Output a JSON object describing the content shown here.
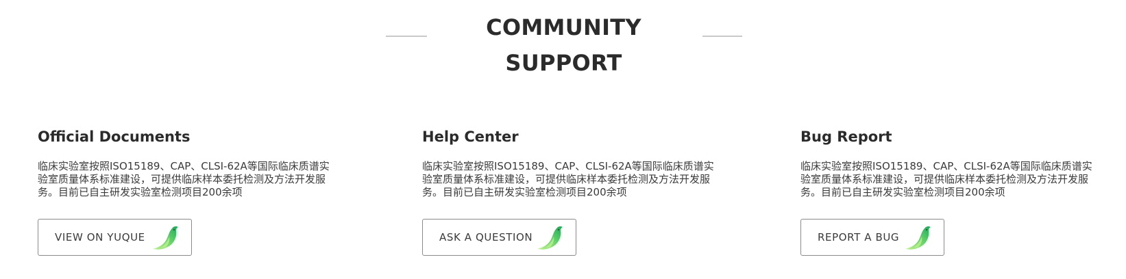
{
  "section": {
    "title": "COMMUNITY SUPPORT"
  },
  "cards": [
    {
      "title": "Official Documents",
      "description": "临床实验室按照ISO15189、CAP、CLSI-62A等国际临床质谱实验室质量体系标准建设，可提供临床样本委托检测及方法开发服务。目前已自主研发实验室检测项目200余项",
      "button_label": "VIEW ON YUQUE",
      "icon": "yuque-bird-icon"
    },
    {
      "title": "Help Center",
      "description": "临床实验室按照ISO15189、CAP、CLSI-62A等国际临床质谱实验室质量体系标准建设，可提供临床样本委托检测及方法开发服务。目前已自主研发实验室检测项目200余项",
      "button_label": "ASK A QUESTION",
      "icon": "yuque-bird-icon"
    },
    {
      "title": "Bug Report",
      "description": "临床实验室按照ISO15189、CAP、CLSI-62A等国际临床质谱实验室质量体系标准建设，可提供临床样本委托检测及方法开发服务。目前已自主研发实验室检测项目200余项",
      "button_label": "REPORT A BUG",
      "icon": "yuque-bird-icon"
    }
  ],
  "colors": {
    "text": "#2b2b2b",
    "rule": "#c9c9c9",
    "button_border": "#8a8a8a",
    "icon_green_light": "#8de36a",
    "icon_green_dark": "#1fb45a"
  }
}
